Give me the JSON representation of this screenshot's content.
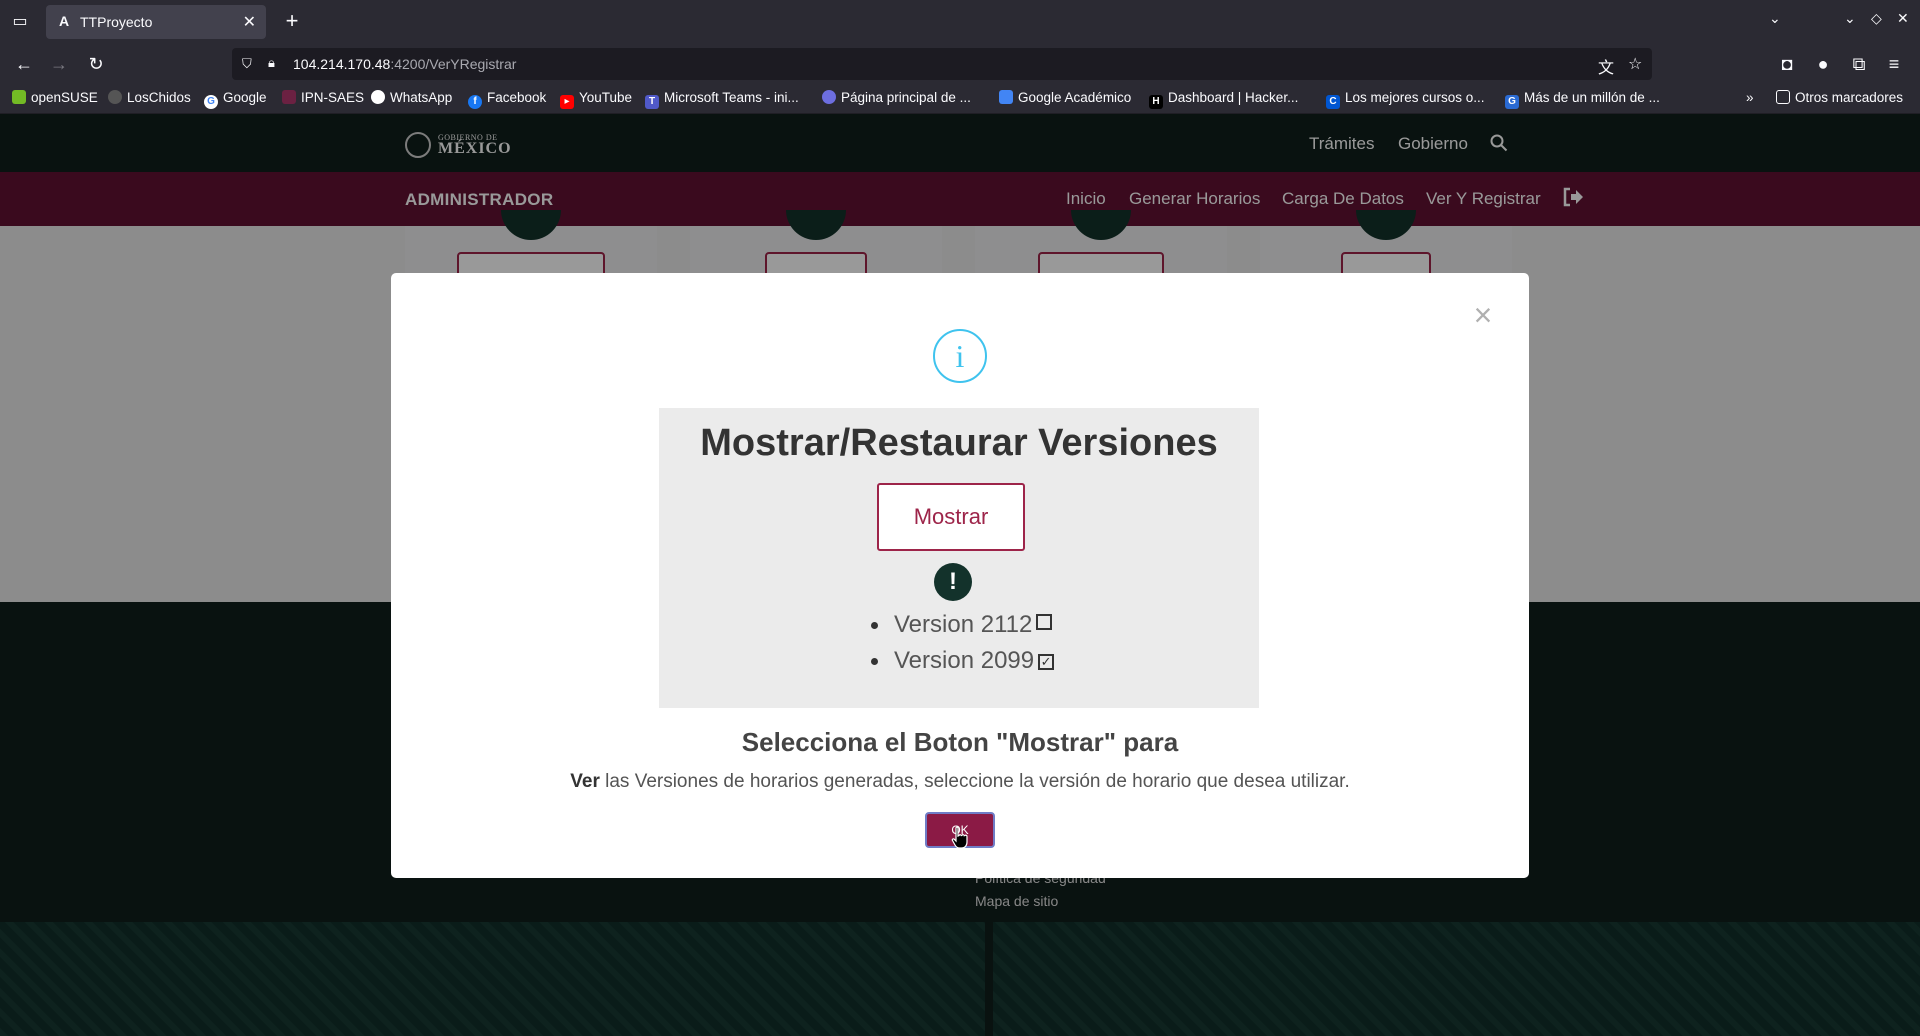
{
  "browser": {
    "tab_title": "TTProyecto",
    "url_host": "104.214.170.48",
    "url_path": ":4200/VerYRegistrar",
    "bookmarks": [
      "openSUSE",
      "LosChidos",
      "Google",
      "IPN-SAES",
      "WhatsApp",
      "Facebook",
      "YouTube",
      "Microsoft Teams - ini...",
      "Página principal de ...",
      "Google Académico",
      "Dashboard | Hacker...",
      "Los mejores cursos o...",
      "Más de un millón de ..."
    ],
    "other_bookmarks": "Otros marcadores"
  },
  "gov": {
    "logo_small": "GOBIERNO DE",
    "logo_big": "MÉXICO",
    "links": [
      "Trámites",
      "Gobierno"
    ]
  },
  "admin": {
    "title": "ADMINISTRADOR",
    "links": [
      "Inicio",
      "Generar Horarios",
      "Carga De Datos",
      "Ver Y Registrar"
    ]
  },
  "footer": {
    "links": [
      "Política de seguridad",
      "Mapa de sitio"
    ]
  },
  "modal": {
    "preview_title": "Mostrar/Restaurar Versiones",
    "preview_button": "Mostrar",
    "versions": [
      {
        "label": "Version 2112",
        "checked": false
      },
      {
        "label": "Version 2099",
        "checked": true
      }
    ],
    "heading": "Selecciona el Boton \"Mostrar\" para",
    "text_bold": "Ver",
    "text_rest": " las Versiones de horarios generadas, seleccione la versión de horario que desea utilizar.",
    "ok_label": "OK"
  },
  "colors": {
    "gov_green": "#0f1e1b",
    "admin_maroon": "#611232",
    "accent": "#9d2449",
    "info_blue": "#3fc3ee"
  }
}
